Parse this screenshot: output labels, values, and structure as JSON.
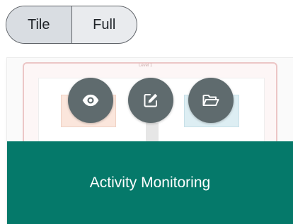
{
  "view_toggle": {
    "options": [
      {
        "label": "Tile",
        "active": true
      },
      {
        "label": "Full",
        "active": false
      }
    ]
  },
  "card": {
    "title": "Activity Monitoring",
    "thumbnail_caption": "Level 1",
    "actions": [
      {
        "name": "view",
        "icon": "eye-icon"
      },
      {
        "name": "edit",
        "icon": "edit-icon"
      },
      {
        "name": "open",
        "icon": "folder-open-icon"
      }
    ],
    "colors": {
      "title_band": "#05796a",
      "action_button": "#5f6b6e"
    }
  }
}
